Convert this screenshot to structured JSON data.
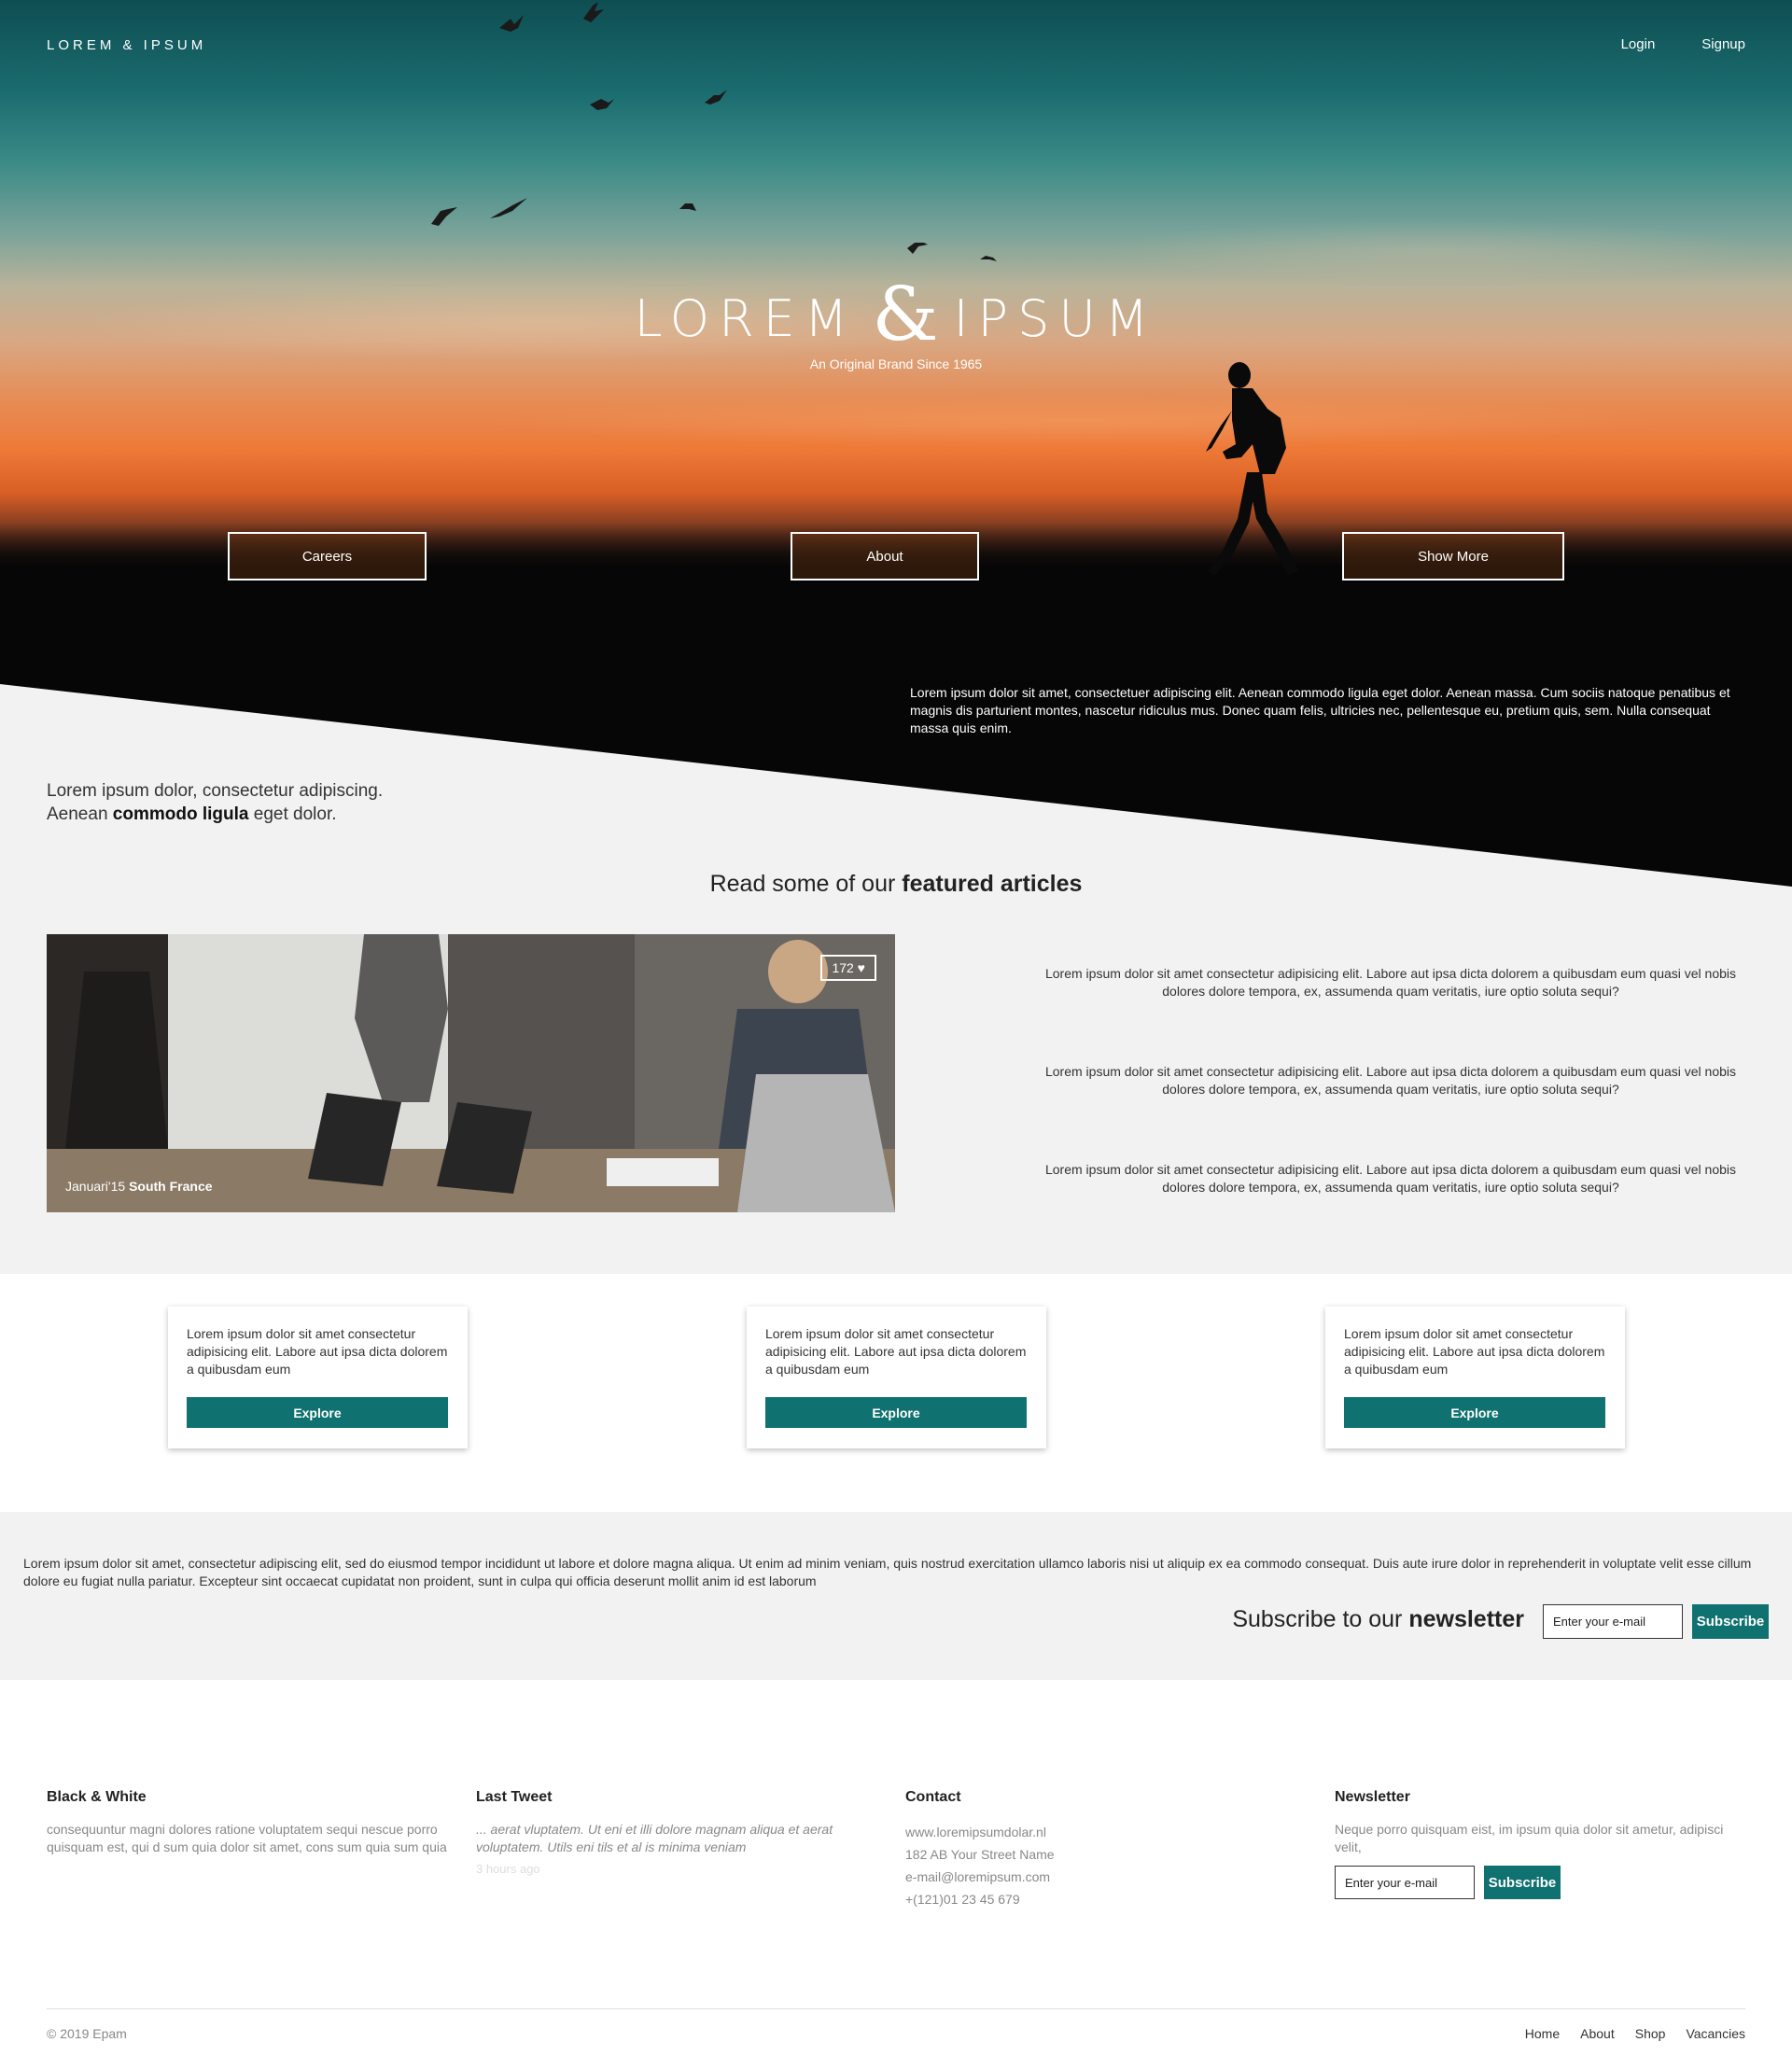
{
  "header": {
    "brand": "LOREM & IPSUM",
    "login": "Login",
    "signup": "Signup"
  },
  "hero": {
    "title_left": "LOREM",
    "title_amp": "&",
    "title_right": "IPSUM",
    "subtitle": "An Original Brand Since 1965",
    "buttons": [
      "Careers",
      "About",
      "Show More"
    ],
    "paragraph": "Lorem ipsum dolor sit amet, consectetuer adipiscing elit. Aenean commodo ligula eget dolor. Aenean massa. Cum sociis natoque penatibus et magnis dis parturient montes, nascetur ridiculus mus. Donec quam felis, ultricies nec, pellentesque eu, pretium quis, sem. Nulla consequat massa quis enim."
  },
  "intro": {
    "line1": "Lorem ipsum dolor, consectetur adipiscing.",
    "line2_pre": "Aenean",
    "line2_bold": "commodo ligula",
    "line2_post": "eget dolor."
  },
  "featured": {
    "title_pre": "Read some of our",
    "title_bold": "featured articles",
    "likes": "172 ♥",
    "caption_date": "Januari'15",
    "caption_place": "South France",
    "texts": [
      "Lorem ipsum dolor sit amet consectetur adipisicing elit. Labore aut ipsa dicta dolorem a quibusdam eum quasi vel nobis dolores dolore tempora, ex, assumenda quam veritatis, iure optio soluta sequi?",
      "Lorem ipsum dolor sit amet consectetur adipisicing elit. Labore aut ipsa dicta dolorem a quibusdam eum quasi vel nobis dolores dolore tempora, ex, assumenda quam veritatis, iure optio soluta sequi?",
      "Lorem ipsum dolor sit amet consectetur adipisicing elit. Labore aut ipsa dicta dolorem a quibusdam eum quasi vel nobis dolores dolore tempora, ex, assumenda quam veritatis, iure optio soluta sequi?"
    ]
  },
  "cards": [
    {
      "text": "Lorem ipsum dolor sit amet consectetur adipisicing elit. Labore aut ipsa dicta dolorem a quibusdam eum",
      "button": "Explore"
    },
    {
      "text": "Lorem ipsum dolor sit amet consectetur adipisicing elit. Labore aut ipsa dicta dolorem a quibusdam eum",
      "button": "Explore"
    },
    {
      "text": "Lorem ipsum dolor sit amet consectetur adipisicing elit. Labore aut ipsa dicta dolorem a quibusdam eum",
      "button": "Explore"
    }
  ],
  "newsletter_band": {
    "paragraph": "Lorem ipsum dolor sit amet, consectetur adipiscing elit, sed do eiusmod tempor incididunt ut labore et dolore magna aliqua. Ut enim ad minim veniam, quis nostrud exercitation ullamco laboris nisi ut aliquip ex ea commodo consequat. Duis aute irure dolor in reprehenderit in voluptate velit esse cillum dolore eu fugiat nulla pariatur. Excepteur sint occaecat cupidatat non proident, sunt in culpa qui officia deserunt mollit anim id est laborum",
    "title_pre": "Subscribe to our",
    "title_bold": "newsletter",
    "input_value": "Enter your e-mail",
    "button": "Subscribe"
  },
  "footer": {
    "col1": {
      "title": "Black & White",
      "text": "consequuntur magni dolores ratione voluptatem sequi nescue porro quisquam est, qui d sum quia dolor sit amet, cons sum quia sum quia"
    },
    "col2": {
      "title": "Last Tweet",
      "text": "... aerat vluptatem. Ut eni et illi dolore magnam aliqua et aerat voluptatem. Utils eni tils et al is minima veniam",
      "ago": "3 hours ago"
    },
    "col3": {
      "title": "Contact",
      "lines": [
        "www.loremipsumdolar.nl",
        "182 AB Your Street Name",
        "e-mail@loremipsum.com",
        "+(121)01 23 45 679"
      ]
    },
    "col4": {
      "title": "Newsletter",
      "text": "Neque porro quisquam eist, im ipsum quia dolor sit ametur, adipisci velit,",
      "input_value": "Enter your e-mail",
      "button": "Subscribe"
    },
    "copyright": "© 2019 Epam",
    "links": [
      "Home",
      "About",
      "Shop",
      "Vacancies"
    ]
  },
  "colors": {
    "accent": "#0f7170",
    "band": "#f2f2f2"
  },
  "icons": [
    "heart-icon"
  ]
}
